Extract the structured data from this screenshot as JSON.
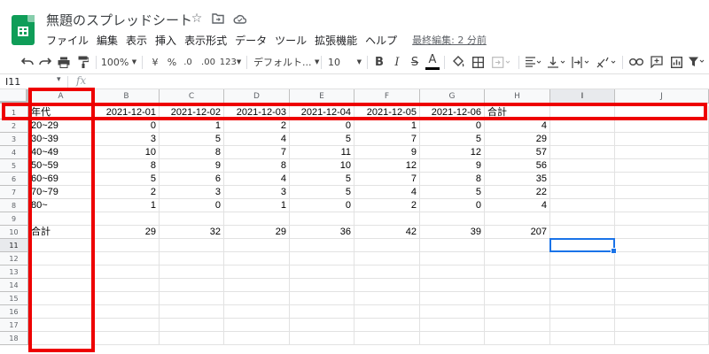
{
  "app": {
    "title": "無題のスプレッドシート",
    "title_icons": [
      "star-icon",
      "move-to-folder-icon",
      "cloud-status-icon"
    ],
    "menu": [
      "ファイル",
      "編集",
      "表示",
      "挿入",
      "表示形式",
      "データ",
      "ツール",
      "拡張機能",
      "ヘルプ"
    ],
    "last_edit": "最終編集: 2 分前"
  },
  "toolbar": {
    "zoom": "100%",
    "currency": "¥",
    "percent": "%",
    "decimal_decrease": ".0",
    "decimal_increase": ".00",
    "more_formats": "123",
    "font": "デフォルト...",
    "font_size": "10",
    "bold": "B",
    "italic": "I",
    "strikethrough": "S",
    "text_color": "A"
  },
  "formula_bar": {
    "name_box": "I11",
    "fx": "fx",
    "content": ""
  },
  "grid": {
    "columns": [
      "A",
      "B",
      "C",
      "D",
      "E",
      "F",
      "G",
      "H",
      "I",
      "J"
    ],
    "rows": [
      "1",
      "2",
      "3",
      "4",
      "5",
      "6",
      "7",
      "8",
      "9",
      "10",
      "11",
      "12",
      "13",
      "14",
      "15",
      "16",
      "17",
      "18"
    ],
    "selected_column": "I",
    "selected_row": "11",
    "active_cell": "I11",
    "cells": [
      [
        "年代",
        "2021-12-01",
        "2021-12-02",
        "2021-12-03",
        "2021-12-04",
        "2021-12-05",
        "2021-12-06",
        "合計",
        "",
        ""
      ],
      [
        "20~29",
        "0",
        "1",
        "2",
        "0",
        "1",
        "0",
        "4",
        "",
        ""
      ],
      [
        "30~39",
        "3",
        "5",
        "4",
        "5",
        "7",
        "5",
        "29",
        "",
        ""
      ],
      [
        "40~49",
        "10",
        "8",
        "7",
        "11",
        "9",
        "12",
        "57",
        "",
        ""
      ],
      [
        "50~59",
        "8",
        "9",
        "8",
        "10",
        "12",
        "9",
        "56",
        "",
        ""
      ],
      [
        "60~69",
        "5",
        "6",
        "4",
        "5",
        "7",
        "8",
        "35",
        "",
        ""
      ],
      [
        "70~79",
        "2",
        "3",
        "3",
        "5",
        "4",
        "5",
        "22",
        "",
        ""
      ],
      [
        "80~",
        "1",
        "0",
        "1",
        "0",
        "2",
        "0",
        "4",
        "",
        ""
      ],
      [
        "",
        "",
        "",
        "",
        "",
        "",
        "",
        "",
        "",
        ""
      ],
      [
        "合計",
        "29",
        "32",
        "29",
        "36",
        "42",
        "39",
        "207",
        "",
        ""
      ],
      [
        "",
        "",
        "",
        "",
        "",
        "",
        "",
        "",
        "",
        ""
      ],
      [
        "",
        "",
        "",
        "",
        "",
        "",
        "",
        "",
        "",
        ""
      ],
      [
        "",
        "",
        "",
        "",
        "",
        "",
        "",
        "",
        "",
        ""
      ],
      [
        "",
        "",
        "",
        "",
        "",
        "",
        "",
        "",
        "",
        ""
      ],
      [
        "",
        "",
        "",
        "",
        "",
        "",
        "",
        "",
        "",
        ""
      ],
      [
        "",
        "",
        "",
        "",
        "",
        "",
        "",
        "",
        "",
        ""
      ],
      [
        "",
        "",
        "",
        "",
        "",
        "",
        "",
        "",
        "",
        ""
      ],
      [
        "",
        "",
        "",
        "",
        "",
        "",
        "",
        "",
        "",
        ""
      ]
    ]
  },
  "colors": {
    "annotation": "#ee0000",
    "selection": "#1a73e8",
    "brand": "#0f9d58"
  }
}
